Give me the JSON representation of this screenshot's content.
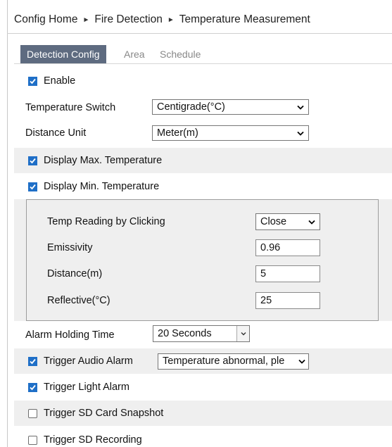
{
  "breadcrumb": {
    "home": "Config Home",
    "level1": "Fire Detection",
    "level2": "Temperature Measurement",
    "separator": "►"
  },
  "tabs": [
    "Detection Config",
    "Area",
    "Schedule"
  ],
  "enable": {
    "label": "Enable",
    "checked": true
  },
  "temperature_switch": {
    "label": "Temperature Switch",
    "value": "Centigrade(°C)"
  },
  "distance_unit": {
    "label": "Distance Unit",
    "value": "Meter(m)"
  },
  "display_max": {
    "label": "Display Max. Temperature",
    "checked": true
  },
  "display_min": {
    "label": "Display Min. Temperature",
    "checked": true
  },
  "panel": {
    "temp_reading": {
      "label": "Temp Reading by Clicking",
      "value": "Close"
    },
    "emissivity": {
      "label": "Emissivity",
      "value": "0.96"
    },
    "distance": {
      "label": "Distance(m)",
      "value": "5"
    },
    "reflective": {
      "label": "Reflective(°C)",
      "value": "25"
    }
  },
  "alarm_holding": {
    "label": "Alarm Holding Time",
    "value": "20 Seconds"
  },
  "trigger_audio": {
    "label": "Trigger Audio Alarm",
    "checked": true,
    "value": "Temperature abnormal, ple"
  },
  "trigger_light": {
    "label": "Trigger Light Alarm",
    "checked": true
  },
  "trigger_sd_snapshot": {
    "label": "Trigger SD Card Snapshot",
    "checked": false
  },
  "trigger_sd_recording": {
    "label": "Trigger SD Recording",
    "checked": false
  },
  "colors": {
    "checkbox": "#1f6fc7",
    "active_tab": "#5e6b80",
    "row_shade": "#efefef"
  }
}
